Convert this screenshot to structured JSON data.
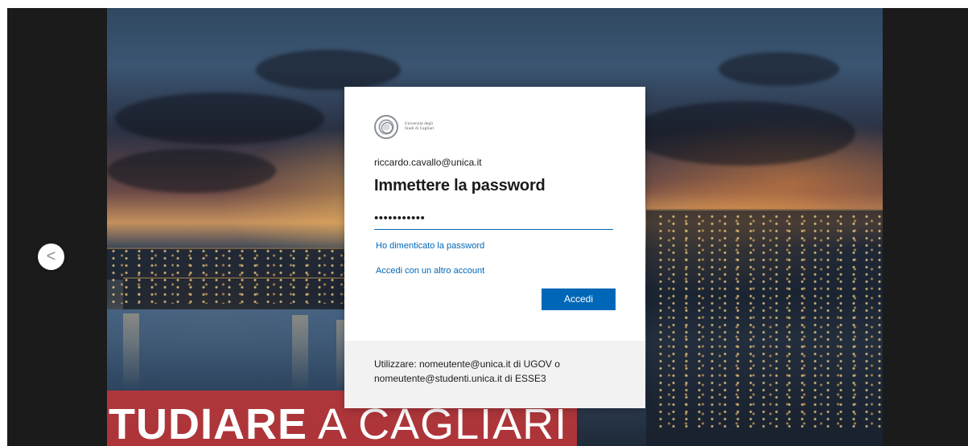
{
  "login": {
    "logo_text": "Università degli Studi di Cagliari",
    "email": "riccardo.cavallo@unica.it",
    "title": "Immettere la password",
    "password_value": "•••••••••••",
    "forgot_password": "Ho dimenticato la password",
    "other_account": "Accedi con un altro account",
    "submit_label": "Accedi",
    "footer_line_1": "Utilizzare: nomeutente@unica.it di UGOV o",
    "footer_line_2": "nomeutente@studenti.unica.it di ESSE3"
  },
  "background": {
    "banner_text_bold": "TUDIARE",
    "banner_text_light": " A CAGLIARI"
  },
  "navigation": {
    "previous_label": "<"
  },
  "colors": {
    "accent": "#0067b8",
    "banner": "#bc3639",
    "frame": "#1b1b1b",
    "footer": "#f2f2f2"
  },
  "icons": {
    "previous": "chevron-left-icon",
    "logo": "university-seal-icon"
  }
}
